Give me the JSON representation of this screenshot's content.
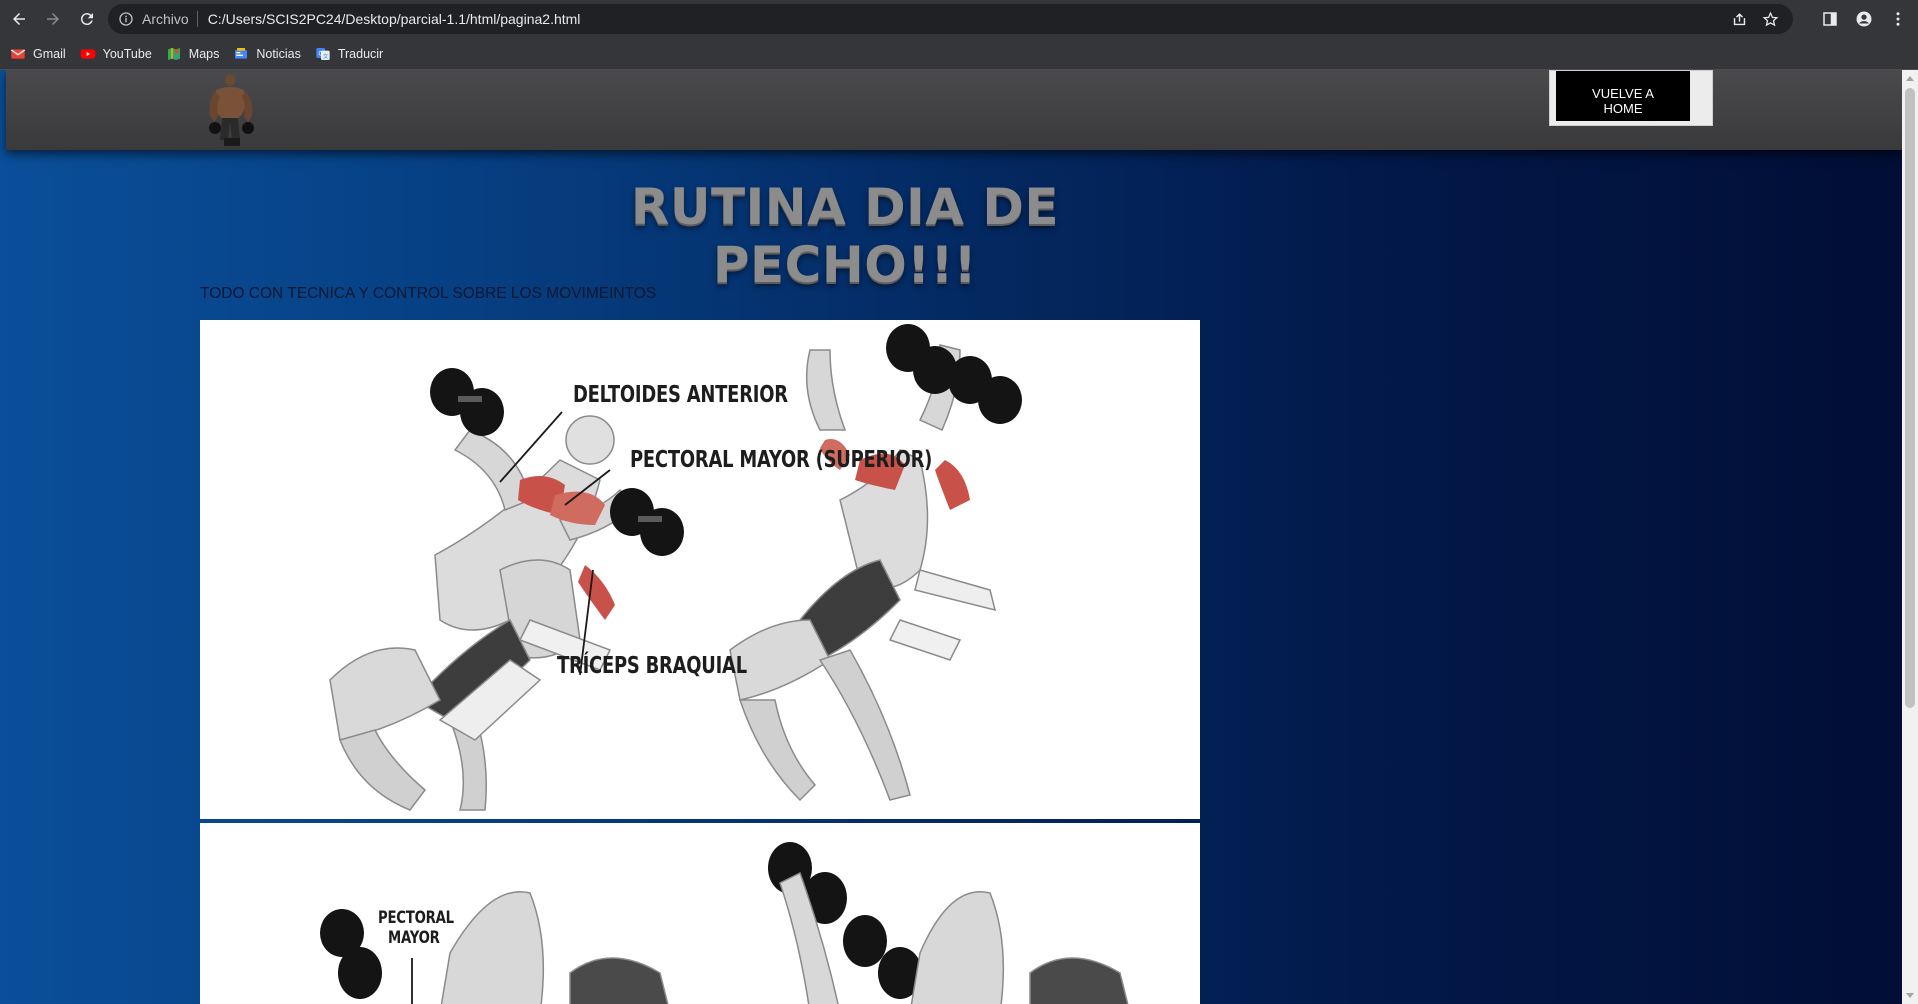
{
  "browser": {
    "scheme_label": "Archivo",
    "url": "C:/Users/SCIS2PC24/Desktop/parcial-1.1/html/pagina2.html",
    "bookmarks": [
      {
        "label": "Gmail",
        "icon": "gmail-icon"
      },
      {
        "label": "YouTube",
        "icon": "youtube-icon"
      },
      {
        "label": "Maps",
        "icon": "maps-icon"
      },
      {
        "label": "Noticias",
        "icon": "news-icon"
      },
      {
        "label": "Traducir",
        "icon": "translate-icon"
      }
    ]
  },
  "header": {
    "home_button_line1": "VUELVE A",
    "home_button_line2": "HOME"
  },
  "main": {
    "title": "RUTINA DIA DE PECHO!!!",
    "subtitle": "TODO CON TECNICA Y CONTROL SOBRE LOS MOVIMEINTOS",
    "image1_labels": {
      "deltoid": "DELTOIDES ANTERIOR",
      "pectoral": "PECTORAL MAYOR (SUPERIOR)",
      "triceps": "TRÍCEPS BRAQUIAL"
    },
    "image2_labels": {
      "pectoral_line1": "PECTORAL",
      "pectoral_line2": "MAYOR"
    }
  },
  "colors": {
    "chrome_bg": "#35363a",
    "omnibox_bg": "#202124",
    "page_gradient_left": "#0a4f9a",
    "page_gradient_right": "#010e35",
    "header_bg": "#3a3a3c",
    "muscle_red": "#c8524a"
  }
}
